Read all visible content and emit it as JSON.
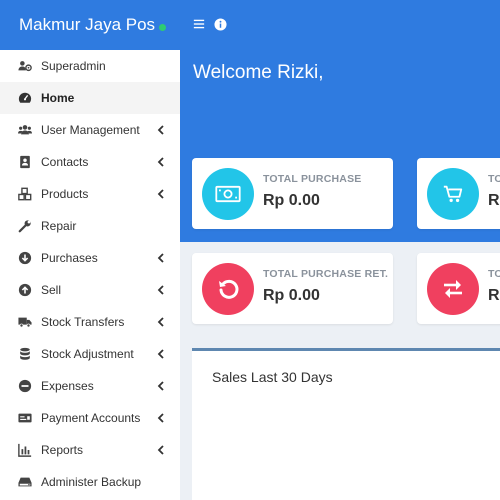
{
  "app": {
    "brand_title": "Makmur Jaya Pos"
  },
  "welcome": "Welcome Rizki,",
  "colors": {
    "primary": "#2f7be0",
    "cyan": "#22c5e8",
    "red": "#f0405f",
    "online": "#2ecc71"
  },
  "sidebar": {
    "items": [
      {
        "label": "Superadmin",
        "icon": "users-cog-icon",
        "has_submenu": false,
        "active": false
      },
      {
        "label": "Home",
        "icon": "dashboard-icon",
        "has_submenu": false,
        "active": true
      },
      {
        "label": "User Management",
        "icon": "users-icon",
        "has_submenu": true,
        "active": false
      },
      {
        "label": "Contacts",
        "icon": "address-book-icon",
        "has_submenu": true,
        "active": false
      },
      {
        "label": "Products",
        "icon": "cubes-icon",
        "has_submenu": true,
        "active": false
      },
      {
        "label": "Repair",
        "icon": "wrench-icon",
        "has_submenu": false,
        "active": false
      },
      {
        "label": "Purchases",
        "icon": "arrow-circle-down-icon",
        "has_submenu": true,
        "active": false
      },
      {
        "label": "Sell",
        "icon": "arrow-circle-up-icon",
        "has_submenu": true,
        "active": false
      },
      {
        "label": "Stock Transfers",
        "icon": "truck-icon",
        "has_submenu": true,
        "active": false
      },
      {
        "label": "Stock Adjustment",
        "icon": "database-icon",
        "has_submenu": true,
        "active": false
      },
      {
        "label": "Expenses",
        "icon": "minus-circle-icon",
        "has_submenu": true,
        "active": false
      },
      {
        "label": "Payment Accounts",
        "icon": "money-check-icon",
        "has_submenu": true,
        "active": false
      },
      {
        "label": "Reports",
        "icon": "bar-chart-icon",
        "has_submenu": true,
        "active": false
      },
      {
        "label": "Administer Backup",
        "icon": "hdd-icon",
        "has_submenu": false,
        "active": false
      }
    ]
  },
  "cards": [
    {
      "label": "TOTAL PURCHASE",
      "value": "Rp 0.00",
      "icon": "money-bill-icon",
      "color": "#22c5e8"
    },
    {
      "label": "TO",
      "value": "R",
      "icon": "shopping-cart-icon",
      "color": "#22c5e8"
    },
    {
      "label": "TOTAL PURCHASE RET...",
      "value": "Rp 0.00",
      "icon": "undo-icon",
      "color": "#f0405f"
    },
    {
      "label": "TO",
      "value": "R",
      "icon": "exchange-icon",
      "color": "#f0405f"
    }
  ],
  "sales_panel": {
    "title": "Sales Last 30 Days"
  }
}
